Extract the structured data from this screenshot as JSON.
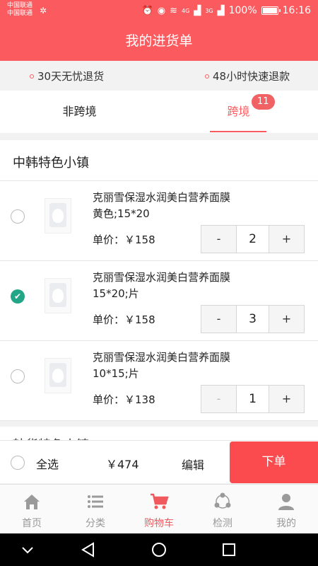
{
  "status_bar": {
    "carrier1": "中国联通",
    "carrier2": "中国联通",
    "network": "4G",
    "network2": "3G",
    "battery": "100%",
    "time": "16:16"
  },
  "header": {
    "title": "我的进货单"
  },
  "promos": [
    "30天无忧退货",
    "48小时快速退款"
  ],
  "tabs": [
    {
      "label": "非跨境",
      "active": false
    },
    {
      "label": "跨境",
      "active": true,
      "badge": "11"
    }
  ],
  "store": {
    "name": "中韩特色小镇"
  },
  "items": [
    {
      "name": "克丽雪保湿水润美白营养面膜",
      "spec": "黄色;15*20",
      "price": "单价：￥158",
      "minus": "-",
      "quantity": "2",
      "plus": "+",
      "checked": false,
      "minus_disabled": false
    },
    {
      "name": "克丽雪保湿水润美白营养面膜",
      "spec": "15*20;片",
      "price": "单价：￥158",
      "minus": "-",
      "quantity": "3",
      "plus": "+",
      "checked": true,
      "minus_disabled": false
    },
    {
      "name": "克丽雪保湿水润美白营养面膜",
      "spec": "10*15;片",
      "price": "单价：￥138",
      "minus": "-",
      "quantity": "1",
      "plus": "+",
      "checked": false,
      "minus_disabled": true
    }
  ],
  "next_store": {
    "name": "韩货特色小镇"
  },
  "footer": {
    "select_all": "全选",
    "total": "￥474",
    "edit": "编辑",
    "order": "下单"
  },
  "tabbar": [
    {
      "label": "首页",
      "icon": "home-icon",
      "active": false
    },
    {
      "label": "分类",
      "icon": "list-icon",
      "active": false
    },
    {
      "label": "购物车",
      "icon": "cart-icon",
      "active": true
    },
    {
      "label": "检测",
      "icon": "share-nodes-icon",
      "active": false
    },
    {
      "label": "我的",
      "icon": "user-icon",
      "active": false
    }
  ],
  "colors": {
    "brand": "#fb5b5f",
    "checked": "#23a687",
    "order_button": "#fb4b4e"
  }
}
